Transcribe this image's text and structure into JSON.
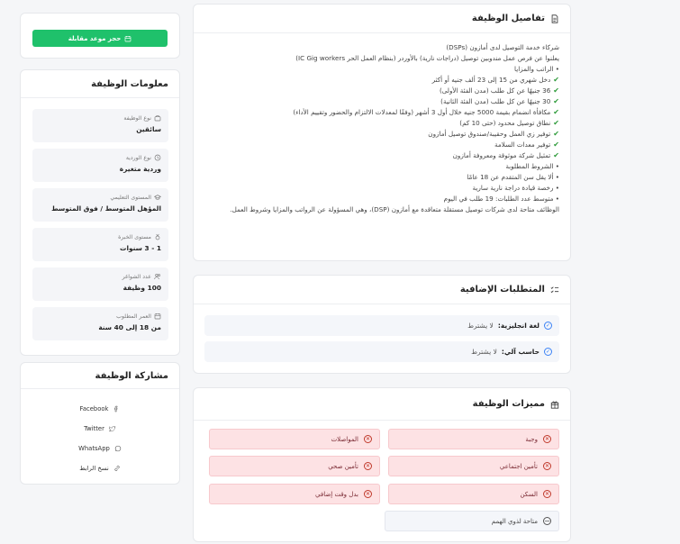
{
  "details": {
    "title": "تفاصيل الوظيفة",
    "lines": [
      {
        "check": false,
        "text": "شركاء خدمة التوصيل لدى أمازون (DSPs)"
      },
      {
        "check": false,
        "text": "يعلنوا عن فرص عمل مندوبين توصيل (دراجات نارية) بالأوردر (بنظام العمل الحر IC Gig workers)"
      },
      {
        "check": false,
        "text": "• الراتب والمزايا"
      },
      {
        "check": true,
        "text": "دخل شهري من 15 إلى 23 ألف جنيه أو أكثر"
      },
      {
        "check": true,
        "text": "36 جنيهًا عن كل طلب (مدن الفئة الأولى)"
      },
      {
        "check": true,
        "text": "30 جنيهًا عن كل طلب (مدن الفئة الثانية)"
      },
      {
        "check": true,
        "text": "مكافأة انضمام بقيمة 5000 جنيه خلال أول 3 أشهر (وفقًا لمعدلات الالتزام والحضور وتقييم الأداء)"
      },
      {
        "check": true,
        "text": "نطاق توصيل محدود (حتى 10 كم)"
      },
      {
        "check": true,
        "text": "توفير زي العمل وحقيبة/صندوق توصيل أمازون"
      },
      {
        "check": true,
        "text": "توفير معدات السلامة"
      },
      {
        "check": true,
        "text": "تمثيل شركة موثوقة ومعروفة أمازون"
      },
      {
        "check": false,
        "text": "• الشروط المطلوبة"
      },
      {
        "check": false,
        "text": "• ألا يقل سن المتقدم عن 18 عامًا"
      },
      {
        "check": false,
        "text": "• رخصة قيادة دراجة نارية سارية"
      },
      {
        "check": false,
        "text": "• متوسط عدد الطلبات: 19 طلب في اليوم"
      },
      {
        "check": false,
        "text": "الوظائف متاحة لدى شركات توصيل مستقلة متعاقدة مع أمازون (DSP)، وهي المسؤولة عن الرواتب والمزايا وشروط العمل."
      }
    ]
  },
  "extra": {
    "title": "المتطلبات الإضافية",
    "items": [
      {
        "label": "لغة انجليزية:",
        "value": "لا يشترط"
      },
      {
        "label": "حاسب آلي:",
        "value": "لا يشترط"
      }
    ]
  },
  "features": {
    "title": "مميزات الوظيفة",
    "items": [
      {
        "label": "وجبة",
        "status": "no"
      },
      {
        "label": "المواصلات",
        "status": "no"
      },
      {
        "label": "تأمين اجتماعي",
        "status": "no"
      },
      {
        "label": "تأمين صحي",
        "status": "no"
      },
      {
        "label": "السكن",
        "status": "no"
      },
      {
        "label": "بدل وقت إضافي",
        "status": "no"
      },
      {
        "label": "متاحة لذوي الهمم",
        "status": "neutral"
      }
    ]
  },
  "apply": {
    "label": "حجز موعد مقابلة"
  },
  "info": {
    "title": "معلومات الوظيفة",
    "items": [
      {
        "label": "نوع الوظيفة",
        "value": "سائقين",
        "icon": "briefcase-icon"
      },
      {
        "label": "نوع الوردية",
        "value": "وردية متغيرة",
        "icon": "clock-icon"
      },
      {
        "label": "المستوى التعليمي",
        "value": "المؤهل المتوسط / فوق المتوسط",
        "icon": "graduation-cap-icon"
      },
      {
        "label": "مستوى الخبرة",
        "value": "1 - 3 سنوات",
        "icon": "medal-icon"
      },
      {
        "label": "عدد الشواغر",
        "value": "100 وظيفة",
        "icon": "users-icon"
      },
      {
        "label": "العمر المطلوب",
        "value": "من 18 إلى 40 سنة",
        "icon": "calendar-icon"
      }
    ]
  },
  "share": {
    "title": "مشاركة الوظيفة",
    "items": [
      {
        "label": "Facebook",
        "icon": "facebook-icon"
      },
      {
        "label": "Twitter",
        "icon": "twitter-icon"
      },
      {
        "label": "WhatsApp",
        "icon": "whatsapp-icon"
      },
      {
        "label": "نسخ الرابط",
        "icon": "link-icon"
      }
    ]
  },
  "colors": {
    "accent": "#1fc16b",
    "negative_bg": "#fde2e4",
    "check": "#2e9b3a",
    "info_blue": "#3b82f6"
  }
}
